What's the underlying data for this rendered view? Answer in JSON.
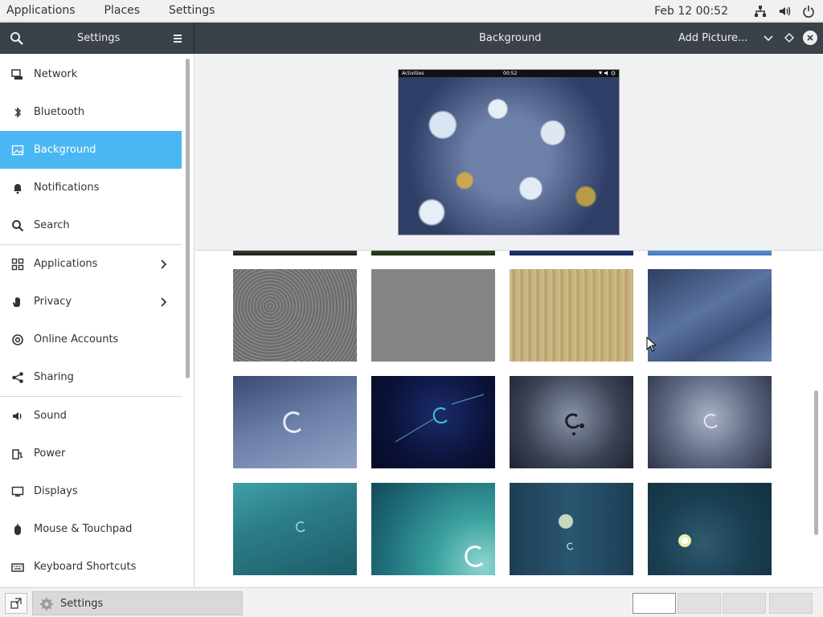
{
  "top_panel": {
    "menus": [
      "Applications",
      "Places",
      "Settings"
    ],
    "clock": "Feb 12  00:52"
  },
  "header": {
    "settings_title": "Settings",
    "page_title": "Background",
    "add_picture": "Add Picture..."
  },
  "sidebar": {
    "items": [
      {
        "label": "Network",
        "icon": "network-icon"
      },
      {
        "label": "Bluetooth",
        "icon": "bluetooth-icon"
      },
      {
        "label": "Background",
        "icon": "background-icon",
        "active": true
      },
      {
        "label": "Notifications",
        "icon": "bell-icon"
      },
      {
        "label": "Search",
        "icon": "search-icon"
      },
      {
        "label": "Applications",
        "icon": "grid-icon",
        "has_submenu": true
      },
      {
        "label": "Privacy",
        "icon": "hand-icon",
        "has_submenu": true
      },
      {
        "label": "Online Accounts",
        "icon": "at-icon"
      },
      {
        "label": "Sharing",
        "icon": "share-icon"
      },
      {
        "label": "Sound",
        "icon": "speaker-icon"
      },
      {
        "label": "Power",
        "icon": "plug-icon"
      },
      {
        "label": "Displays",
        "icon": "display-icon"
      },
      {
        "label": "Mouse & Touchpad",
        "icon": "mouse-icon"
      },
      {
        "label": "Keyboard Shortcuts",
        "icon": "keyboard-icon"
      }
    ]
  },
  "preview": {
    "bar_left": "Activities",
    "bar_center": "00:52"
  },
  "taskbar": {
    "task_label": "Settings"
  },
  "colors": {
    "accent": "#4ab6f2",
    "header": "#3a4149"
  }
}
